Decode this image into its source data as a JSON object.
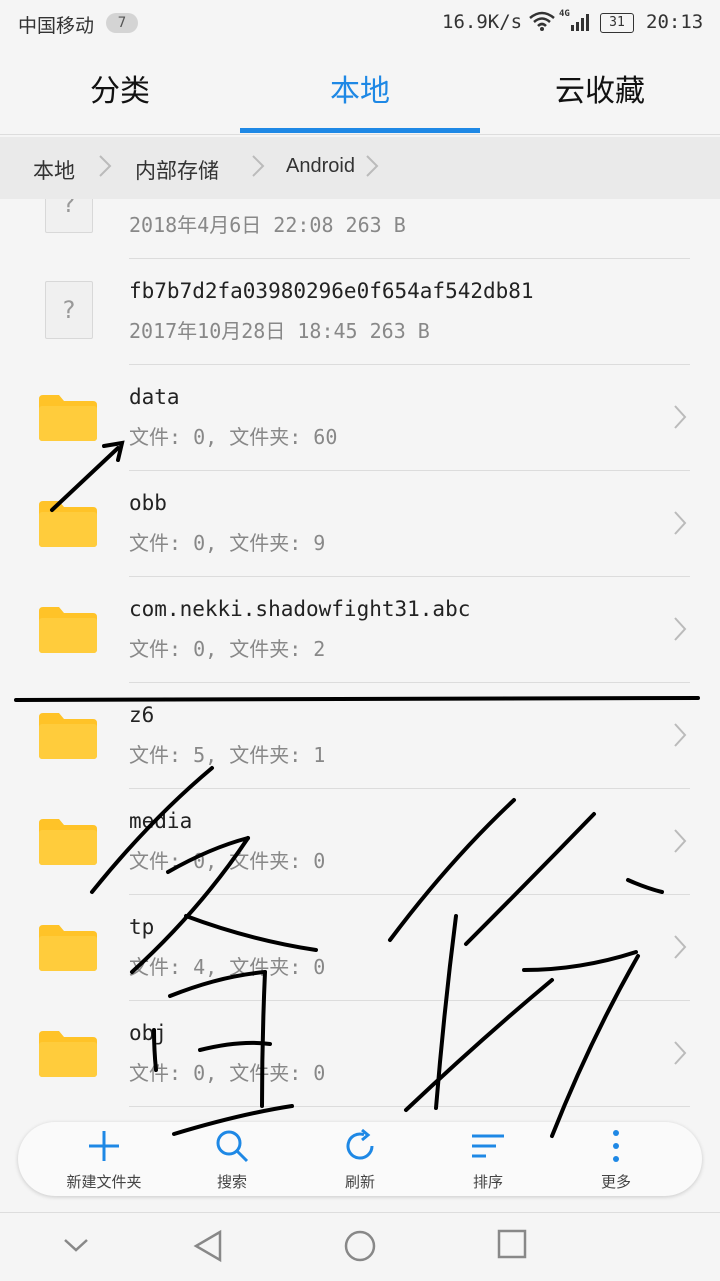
{
  "status_bar": {
    "carrier": "中国移动",
    "notification_count": "7",
    "speed": "16.9K/s",
    "network_type": "4G",
    "battery": "31",
    "time": "20:13"
  },
  "tabs": [
    {
      "label": "分类",
      "active": false
    },
    {
      "label": "本地",
      "active": true
    },
    {
      "label": "云收藏",
      "active": false
    }
  ],
  "accent_color": "#1e88e5",
  "folder_color": "#ffc328",
  "breadcrumb": [
    "本地",
    "内部存储",
    "Android"
  ],
  "files": [
    {
      "type": "file",
      "name": "",
      "meta": "2018年4月6日 22:08 263 B"
    },
    {
      "type": "file",
      "name": "fb7b7d2fa03980296e0f654af542db81",
      "meta": "2017年10月28日 18:45 263 B"
    },
    {
      "type": "folder",
      "name": "data",
      "meta": "文件: 0, 文件夹: 60"
    },
    {
      "type": "folder",
      "name": "obb",
      "meta": "文件: 0, 文件夹: 9"
    },
    {
      "type": "folder",
      "name": "com.nekki.shadowfight31.abc",
      "meta": "文件: 0, 文件夹: 2"
    },
    {
      "type": "folder",
      "name": "z6",
      "meta": "文件: 5, 文件夹: 1"
    },
    {
      "type": "folder",
      "name": "media",
      "meta": "文件: 0, 文件夹: 0"
    },
    {
      "type": "folder",
      "name": "tp",
      "meta": "文件: 4, 文件夹: 0"
    },
    {
      "type": "folder",
      "name": "obj",
      "meta": "文件: 0, 文件夹: 0"
    }
  ],
  "toolbar": [
    {
      "label": "新建文件夹",
      "icon": "plus-icon"
    },
    {
      "label": "搜索",
      "icon": "search-icon"
    },
    {
      "label": "刷新",
      "icon": "refresh-icon"
    },
    {
      "label": "排序",
      "icon": "sort-icon"
    },
    {
      "label": "更多",
      "icon": "more-icon"
    }
  ],
  "nav": [
    "back-chevron-icon",
    "back-triangle-icon",
    "home-circle-icon",
    "recents-square-icon"
  ]
}
